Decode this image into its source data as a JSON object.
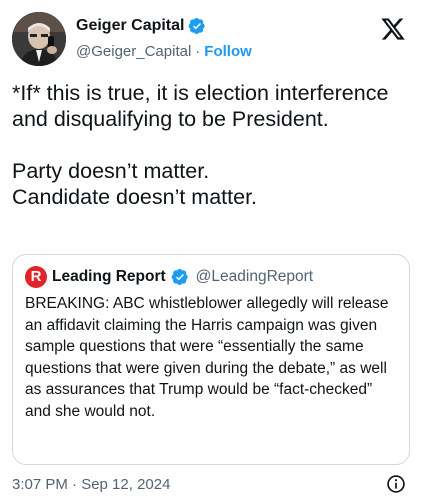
{
  "author": {
    "name": "Geiger Capital",
    "handle": "@Geiger_Capital",
    "separator": "·",
    "follow_label": "Follow",
    "avatar_icon": "profile-photo-man-on-phone",
    "verified_icon": "verified-badge-icon"
  },
  "tweet": {
    "text": "*If* this is true, it is election interference and disqualifying to be President.\n\nParty doesn’t matter.\nCandidate doesn’t matter."
  },
  "quote": {
    "name": "Leading Report",
    "handle": "@LeadingReport",
    "avatar_letter": "R",
    "body": "BREAKING: ABC whistleblower allegedly will release an affidavit claiming the Harris campaign was given sample questions that were “essentially the same questions that were given during the debate,” as well as assurances that Trump would be “fact-checked” and she would not."
  },
  "meta": {
    "timestamp": "3:07 PM · Sep 12, 2024"
  },
  "colors": {
    "accent": "#1d9bf0",
    "text": "#0f1419",
    "secondary": "#536471",
    "border": "#cfd9de",
    "quote_avatar": "#e0242a"
  },
  "icons": [
    "x-logo-icon",
    "verified-badge-icon",
    "info-icon"
  ]
}
